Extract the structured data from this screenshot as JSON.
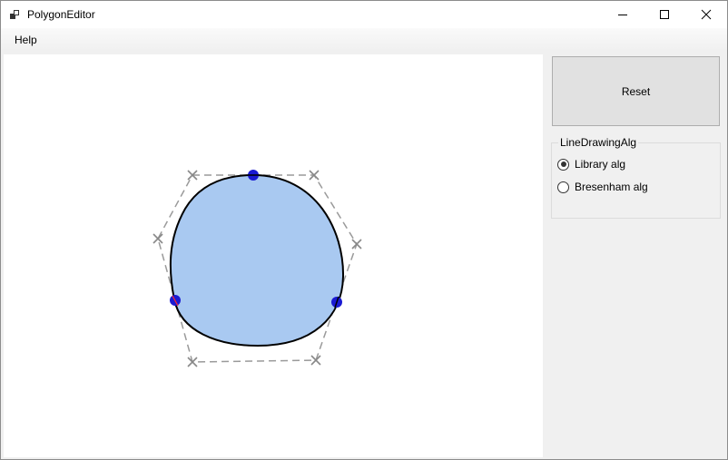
{
  "window": {
    "title": "PolygonEditor",
    "icon": "app-icon",
    "controls": [
      "minimize-icon",
      "maximize-icon",
      "close-icon"
    ]
  },
  "menu": {
    "items": [
      {
        "label": "Help"
      }
    ]
  },
  "sidebar": {
    "reset_label": "Reset",
    "group": {
      "legend": "LineDrawingAlg",
      "options": [
        {
          "label": "Library alg",
          "checked": true
        },
        {
          "label": "Bresenham alg",
          "checked": false
        }
      ]
    }
  },
  "colors": {
    "shape_fill": "#a9c9f1",
    "shape_stroke": "#000000",
    "control_line": "#9a9a9a",
    "vertex_fill": "#1a1ad2"
  }
}
